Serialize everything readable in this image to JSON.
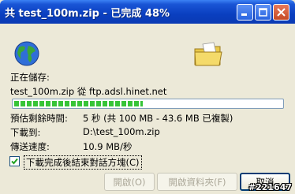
{
  "window": {
    "title": "共 test_100m.zip - 已完成 48%"
  },
  "dialog": {
    "saving_label": "正在儲存:",
    "file_source": "test_100m.zip 從 ftp.adsl.hinet.net",
    "progress_percent": 48,
    "rows": [
      {
        "label": "預估剩餘時間:",
        "value": "5 秒 (共 100 MB - 43.6 MB 已複製)"
      },
      {
        "label": "下載到:",
        "value": "D:\\test_100m.zip"
      },
      {
        "label": "傳送速度:",
        "value": "10.9 MB/秒"
      }
    ],
    "close_when_done": {
      "label": "下載完成後結束對話方塊(C)",
      "checked": true
    }
  },
  "buttons": {
    "open": "開啟(O)",
    "open_folder": "開啟資料夾(F)",
    "cancel": "取消"
  },
  "watermark": "#221647",
  "colors": {
    "titlebar": "#0a3fc0",
    "progress": "#37c437",
    "dialog_bg": "#ece9d8"
  },
  "icons": [
    "globe-icon",
    "folder-icon",
    "minimize-icon",
    "maximize-icon",
    "close-icon"
  ]
}
